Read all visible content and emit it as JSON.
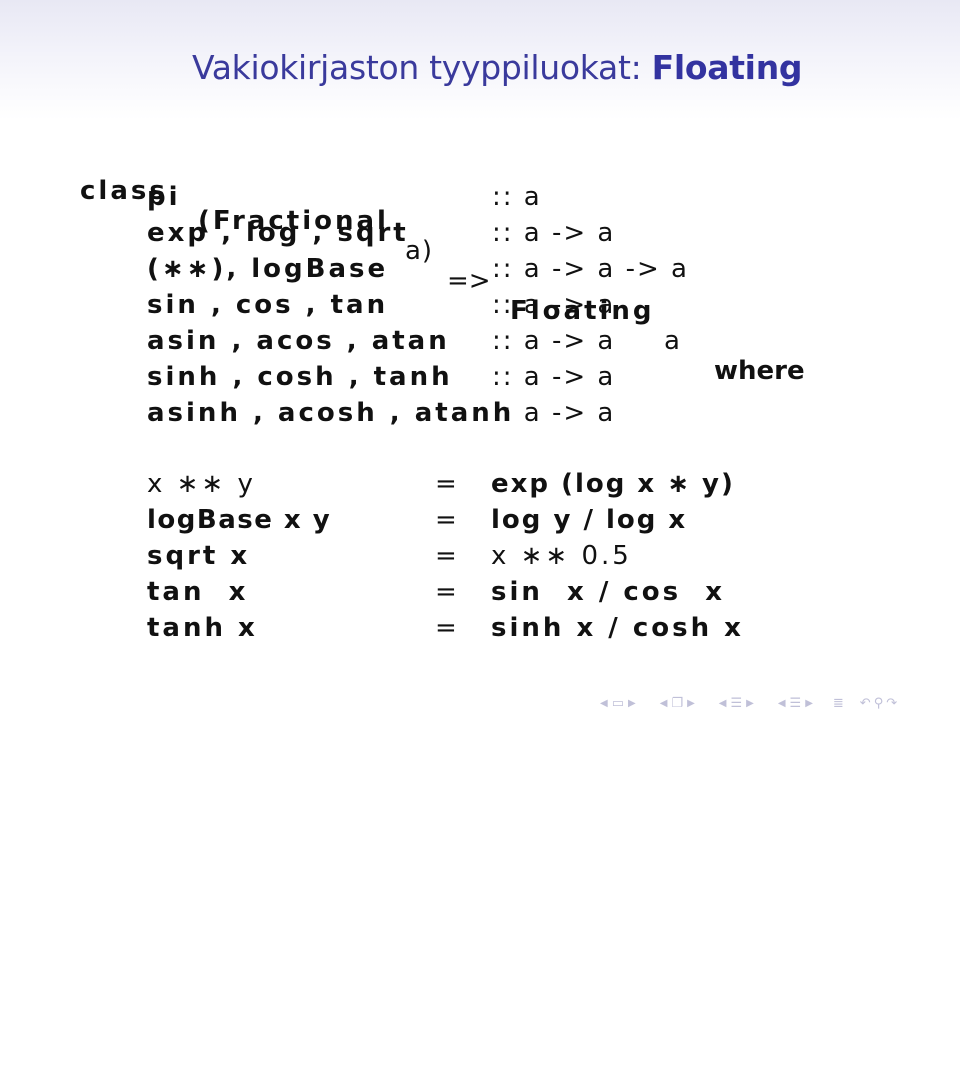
{
  "slide": {
    "title_prefix": "Vakiokirjaston tyyppiluokat: ",
    "title_emph": "Floating"
  },
  "class_decl": {
    "keyword_class": "class",
    "context": "(Fractional",
    "context_var": "a)",
    "arrow": "=>",
    "class_name": "Floating",
    "class_var": "a",
    "keyword_where": "where"
  },
  "signatures": [
    {
      "names": "pi",
      "type": ":: a"
    },
    {
      "names": "exp , log , sqrt",
      "type": ":: a -> a"
    },
    {
      "names": "(∗∗), logBase",
      "type": ":: a -> a -> a"
    },
    {
      "names": "sin , cos , tan",
      "type": ":: a -> a"
    },
    {
      "names": "asin , acos , atan",
      "type": ":: a -> a"
    },
    {
      "names": "sinh , cosh , tanh",
      "type": ":: a -> a"
    },
    {
      "names": "asinh , acosh , atanh",
      "type": ":: a -> a"
    }
  ],
  "defaults": [
    {
      "lhs": "x ∗∗ y",
      "eq": "=",
      "rhs": "exp (log x ∗ y)"
    },
    {
      "lhs": "logBase x y",
      "eq": "=",
      "rhs": "log y / log x"
    },
    {
      "lhs": "sqrt x",
      "eq": "=",
      "rhs": "x ∗∗ 0.5"
    },
    {
      "lhs": "tan  x",
      "eq": "=",
      "rhs": "sin  x / cos  x"
    },
    {
      "lhs": "tanh x",
      "eq": "=",
      "rhs": "sinh x / cosh x"
    }
  ],
  "nav": {
    "icons": [
      "frame-prev-icon",
      "frame-icon",
      "frame-next-icon",
      "subsection-prev-icon",
      "subsection-icon",
      "subsection-next-icon",
      "section-prev-icon",
      "section-icon",
      "section-next-icon",
      "slide-prev-icon",
      "slide-icon",
      "slide-next-icon",
      "toc-icon",
      "back-icon",
      "search-icon",
      "forward-icon"
    ]
  }
}
